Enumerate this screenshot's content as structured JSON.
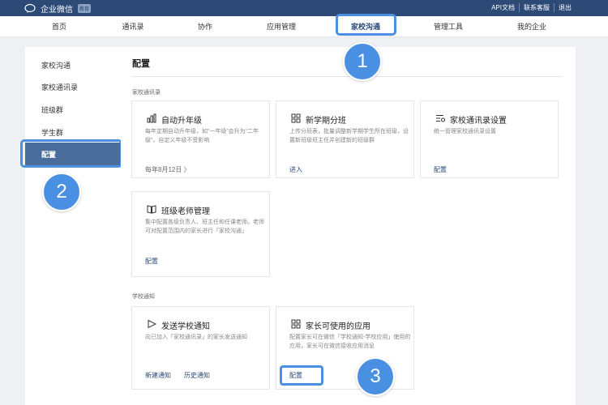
{
  "header": {
    "logo_text": "企业微信",
    "logo_badge": "教育",
    "links": [
      "API文档",
      "联系客服",
      "退出"
    ]
  },
  "nav": {
    "items": [
      "首页",
      "通讯录",
      "协作",
      "应用管理",
      "家校沟通",
      "管理工具",
      "我的企业"
    ],
    "active_index": 4
  },
  "sidebar": {
    "items": [
      "家校沟通",
      "家校通讯录",
      "班级群",
      "学生群"
    ],
    "active": "配置"
  },
  "main": {
    "title": "配置",
    "sections": [
      {
        "label": "家校通讯录",
        "cards": [
          {
            "title": "自动升年级",
            "icon": "bar-chart-icon",
            "desc": "每年定期自动升年级，如“一年级”会升为“二年级”。自定义年级不受影响",
            "links": [
              "每年8月12日 〉"
            ]
          },
          {
            "title": "新学期分班",
            "icon": "grid-icon",
            "desc": "上传分班表，批量调整新学期学生所在班级，设置新班级班主任并创建新的班级群",
            "links": [
              "进入"
            ]
          },
          {
            "title": "家校通讯录设置",
            "icon": "list-settings-icon",
            "desc": "统一管理家校通讯录设置",
            "links": [
              "配置"
            ]
          },
          {
            "title": "班级老师管理",
            "icon": "book-icon",
            "desc": "集中配置各级负责人、班主任和任课老师。老师可对配置范围内的家长进行「家校沟通」",
            "links": [
              "配置"
            ]
          }
        ]
      },
      {
        "label": "学校通知",
        "cards": [
          {
            "title": "发送学校通知",
            "icon": "send-icon",
            "desc": "向已加入「家校通讯录」的家长发送通知",
            "links": [
              "新建通知",
              "历史通知"
            ]
          },
          {
            "title": "家长可使用的应用",
            "icon": "apps-icon",
            "desc": "配置家长可在微信「学校通知-学校应用」使用的应用，家长可在微信接收应用消息",
            "links": [
              "配置"
            ]
          }
        ]
      }
    ]
  },
  "badges": [
    "1",
    "2",
    "3"
  ],
  "colors": {
    "header_bg": "#2d4a77",
    "accent": "#4a90e2",
    "sidebar_active": "#4a6c9b"
  }
}
